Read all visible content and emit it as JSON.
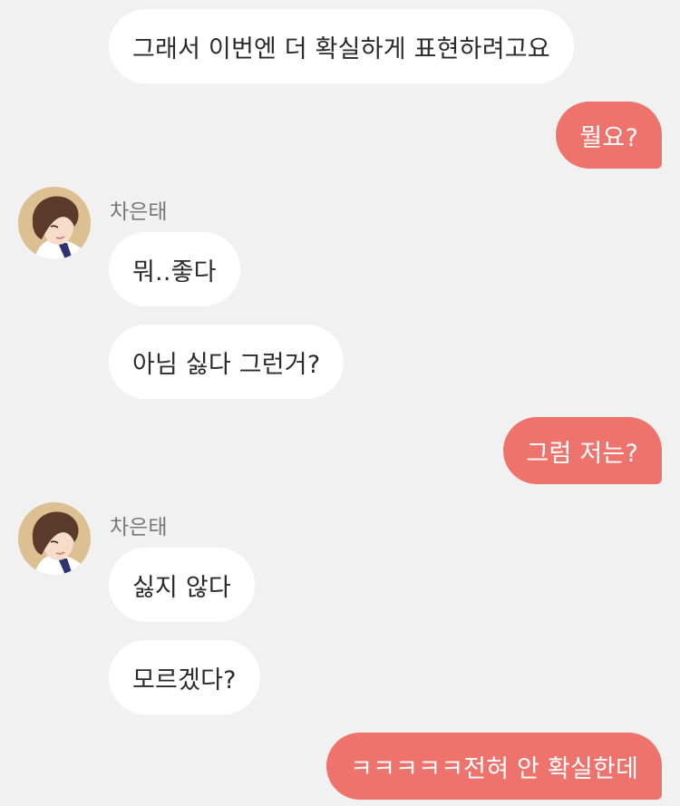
{
  "sender": {
    "name": "차은태"
  },
  "messages": {
    "m0": "그래서 이번엔 더 확실하게 표현하려고요",
    "m1": "뭘요?",
    "m2": "뭐..좋다",
    "m3": "아님 싫다 그런거?",
    "m4": "그럼 저는?",
    "m5": "싫지 않다",
    "m6": "모르겠다?",
    "m7": "ㅋㅋㅋㅋㅋ전혀 안 확실한데"
  },
  "colors": {
    "background": "#f1f1f1",
    "received_bubble": "#ffffff",
    "sent_bubble": "#ee736d",
    "avatar_bg": "#dcc091"
  }
}
